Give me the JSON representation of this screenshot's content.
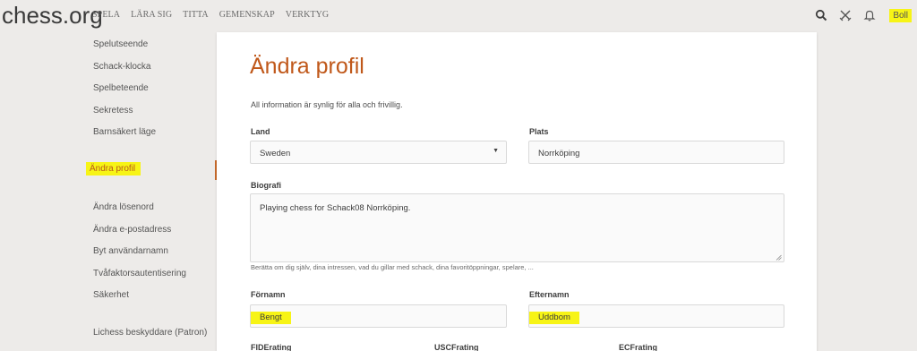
{
  "header": {
    "logo": "chess.org",
    "nav": [
      "SPELA",
      "LÄRA SIG",
      "TITTA",
      "GEMENSKAP",
      "VERKTYG"
    ],
    "user": "Boll",
    "icons": [
      "search-icon",
      "swords-icon",
      "bell-icon"
    ]
  },
  "sidebar": {
    "items": [
      {
        "label": "Spelutseende"
      },
      {
        "label": "Schack-klocka"
      },
      {
        "label": "Spelbeteende"
      },
      {
        "label": "Sekretess"
      },
      {
        "label": "Barnsäkert läge"
      },
      {
        "label": "Ändra profil"
      },
      {
        "label": "Ändra lösenord"
      },
      {
        "label": "Ändra e-postadress"
      },
      {
        "label": "Byt användarnamn"
      },
      {
        "label": "Tvåfaktorsautentisering"
      },
      {
        "label": "Säkerhet"
      },
      {
        "label": "Lichess beskyddare (Patron)"
      }
    ],
    "active": "Ändra profil"
  },
  "main": {
    "title": "Ändra profil",
    "info": "All information är synlig för alla och frivillig.",
    "land_label": "Land",
    "land_value": "Sweden",
    "plats_label": "Plats",
    "plats_value": "Norrköping",
    "bio_label": "Biografi",
    "bio_value": "Playing chess for Schack08 Norrköping.",
    "bio_help": "Berätta om dig själv, dina intressen, vad du gillar med schack, dina favoritöppningar, spelare, ...",
    "fornamn_label": "Förnamn",
    "fornamn_value": "Bengt",
    "efternamn_label": "Efternamn",
    "efternamn_value": "Uddbom",
    "fide_label": "FIDErating",
    "usc_label": "USCFrating",
    "ecf_label": "ECFrating"
  },
  "colors": {
    "accent": "#c0581a",
    "highlight": "#f7f416",
    "background": "#edebe9"
  }
}
